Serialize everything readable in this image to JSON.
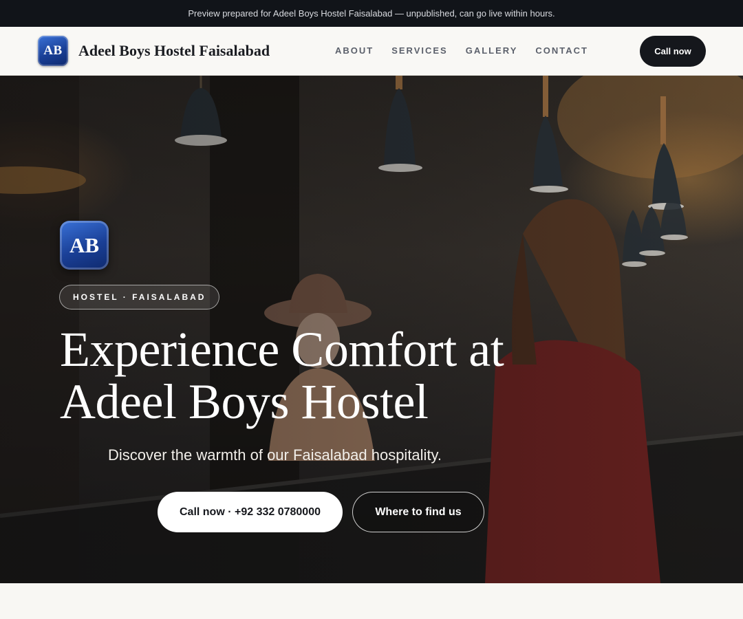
{
  "preview_banner": "Preview prepared for Adeel Boys Hostel Faisalabad — unpublished, can go live within hours.",
  "header": {
    "logo_text": "AB",
    "brand_name": "Adeel Boys Hostel Faisalabad",
    "nav": [
      {
        "label": "ABOUT"
      },
      {
        "label": "SERVICES"
      },
      {
        "label": "GALLERY"
      },
      {
        "label": "CONTACT"
      }
    ],
    "cta_label": "Call now"
  },
  "hero": {
    "logo_text": "AB",
    "tag": "HOSTEL · FAISALABAD",
    "title": "Experience Comfort at Adeel Boys Hostel",
    "subtitle": "Discover the warmth of our Faisalabad hospitality.",
    "primary_button": "Call now · +92 332 0780000",
    "secondary_button": "Where to find us",
    "background_image": "hotel-reception-photo"
  },
  "colors": {
    "dark": "#15171c",
    "brand_blue": "#1a3f96",
    "page_bg": "#f7f5f1"
  }
}
